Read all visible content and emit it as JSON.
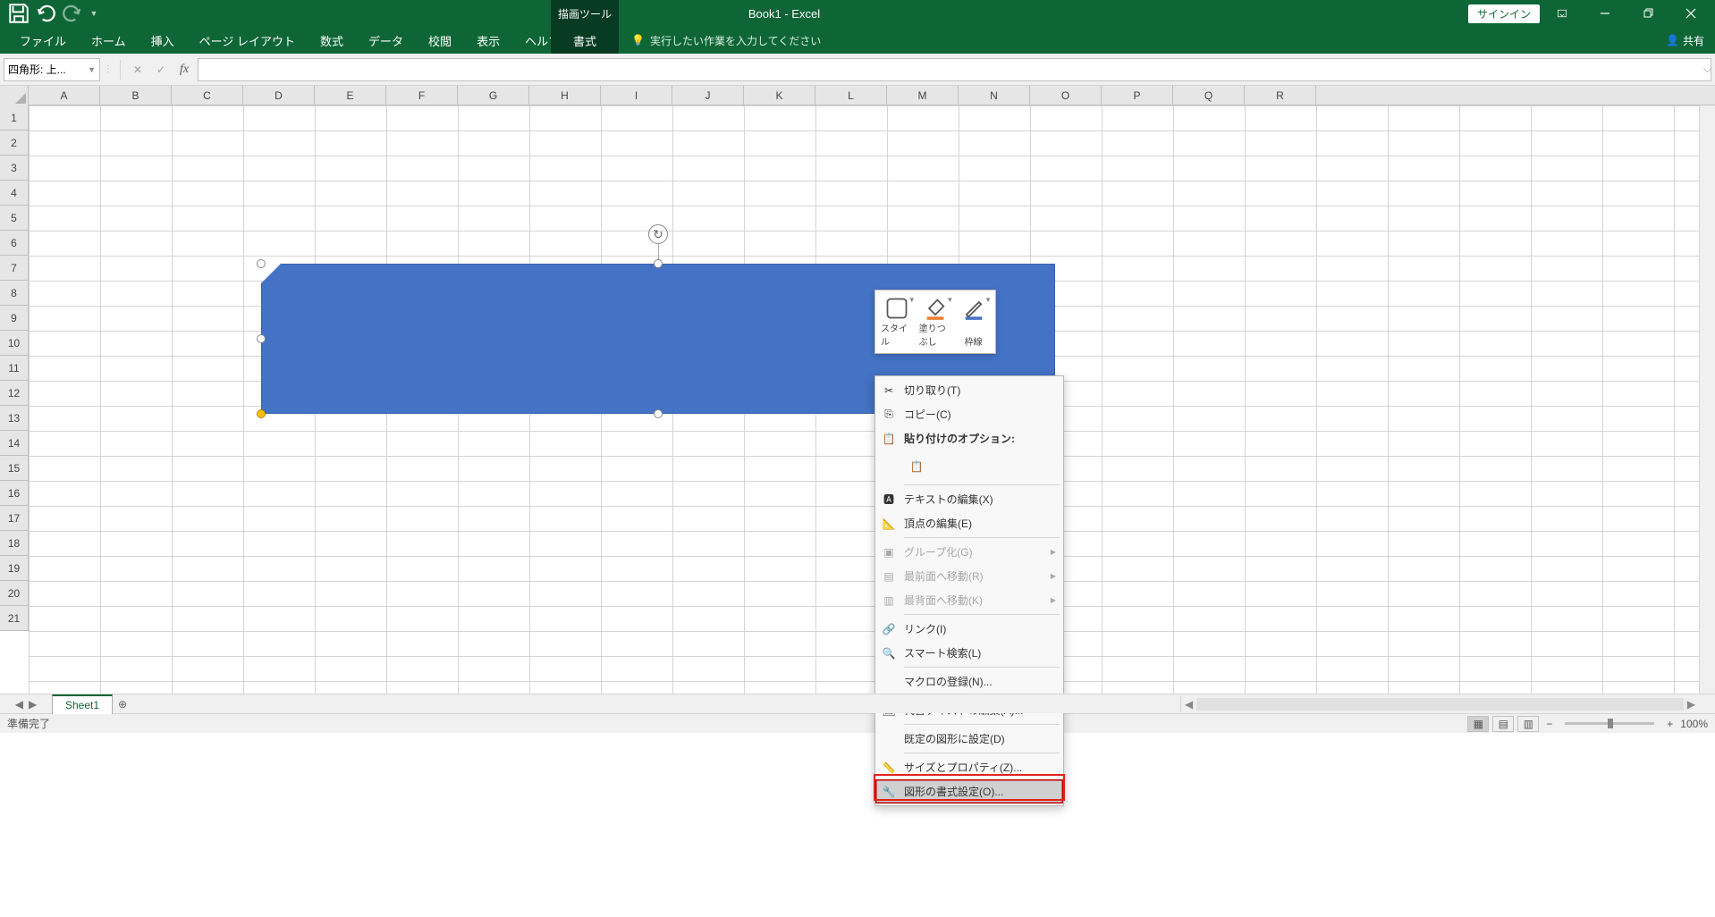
{
  "title": "Book1  -  Excel",
  "drawing_tools": "描画ツール",
  "signin": "サインイン",
  "ribbon": {
    "tabs": [
      "ファイル",
      "ホーム",
      "挿入",
      "ページ レイアウト",
      "数式",
      "データ",
      "校閲",
      "表示",
      "ヘルプ",
      "書式"
    ],
    "active_index": 9,
    "tell_me": "実行したい作業を入力してください",
    "share": "共有"
  },
  "name_box": "四角形: 上...",
  "columns": [
    "A",
    "B",
    "C",
    "D",
    "E",
    "F",
    "G",
    "H",
    "I",
    "J",
    "K",
    "L",
    "M",
    "N",
    "O",
    "P",
    "Q",
    "R"
  ],
  "rows": [
    "1",
    "2",
    "3",
    "4",
    "5",
    "6",
    "7",
    "8",
    "9",
    "10",
    "11",
    "12",
    "13",
    "14",
    "15",
    "16",
    "17",
    "18",
    "19",
    "20",
    "21"
  ],
  "mini_toolbar": {
    "style": "スタイル",
    "fill": "塗りつぶし",
    "outline": "枠線"
  },
  "context_menu": {
    "cut": "切り取り(T)",
    "copy": "コピー(C)",
    "paste_options": "貼り付けのオプション:",
    "edit_text": "テキストの編集(X)",
    "edit_points": "頂点の編集(E)",
    "group": "グループ化(G)",
    "bring_front": "最前面へ移動(R)",
    "send_back": "最背面へ移動(K)",
    "link": "リンク(I)",
    "smart_lookup": "スマート検索(L)",
    "assign_macro": "マクロの登録(N)...",
    "alt_text": "代替テキストの編集(A)...",
    "set_default": "既定の図形に設定(D)",
    "size_props": "サイズとプロパティ(Z)...",
    "format_shape": "図形の書式設定(O)..."
  },
  "sheet_tab": "Sheet1",
  "status": "準備完了",
  "zoom": "100%"
}
